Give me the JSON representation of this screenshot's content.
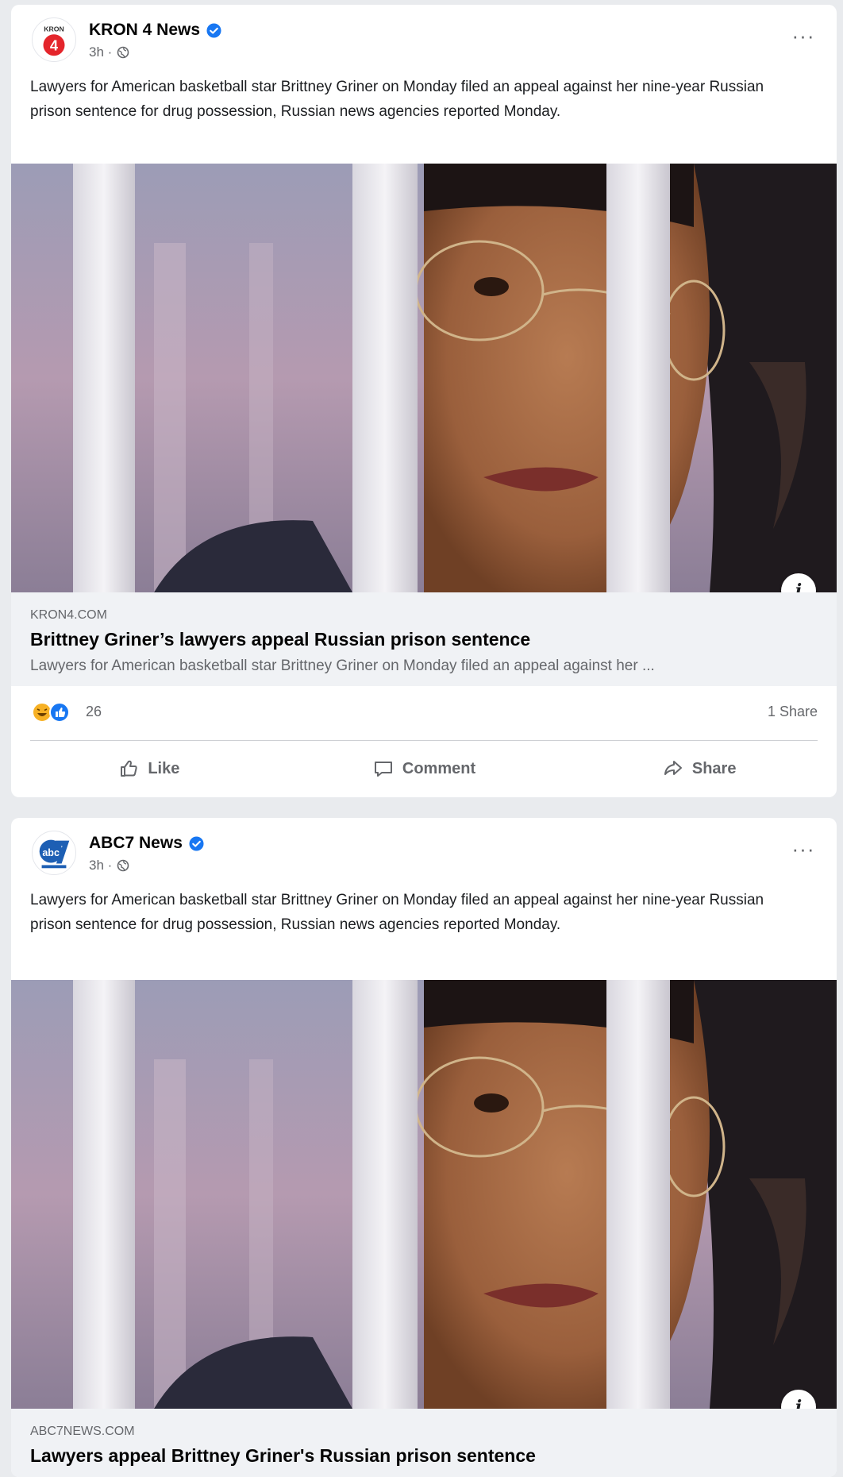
{
  "posts": [
    {
      "page_name": "KRON 4 News",
      "time": "3h ·",
      "avatar_text": "KRON",
      "avatar_number": "4",
      "text": "Lawyers for American basketball star Brittney Griner on Monday filed an appeal against her nine-year Russian prison sentence for drug possession, Russian news agencies reported Monday.",
      "more_label": "···",
      "info_label": "i",
      "link": {
        "domain": "KRON4.COM",
        "title": "Brittney Griner’s lawyers appeal Russian prison sentence",
        "description": "Lawyers for American basketball star Brittney Griner on Monday filed an appeal against her ..."
      },
      "reaction_count": "26",
      "share_count": "1 Share",
      "actions": {
        "like": "Like",
        "comment": "Comment",
        "share": "Share"
      }
    },
    {
      "page_name": "ABC7 News",
      "time": "3h ·",
      "avatar_text": "ABC7",
      "text": "Lawyers for American basketball star Brittney Griner on Monday filed an appeal against her nine-year Russian prison sentence for drug possession, Russian news agencies reported Monday.",
      "more_label": "···",
      "info_label": "i",
      "link": {
        "domain": "ABC7NEWS.COM",
        "title": "Lawyers appeal Brittney Griner's Russian prison sentence"
      }
    }
  ],
  "colors": {
    "background": "#e9ebee",
    "verified_blue": "#1877f2",
    "secondary_text": "#65676b",
    "kron_red": "#e4252b",
    "abc_blue": "#1d5fb4"
  }
}
